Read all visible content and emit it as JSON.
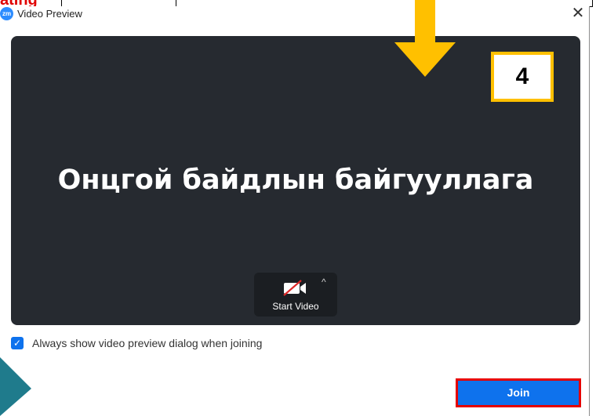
{
  "background_slide": {
    "red_text": "ating"
  },
  "window": {
    "title": "Video Preview",
    "logo_text": "zm",
    "close_glyph": "✕"
  },
  "preview": {
    "display_name": "Онцгой байдлын байгууллага",
    "start_video_label": "Start Video",
    "caret_glyph": "^"
  },
  "overlay": {
    "step_number": "4",
    "arrow_color": "#ffc000"
  },
  "options": {
    "always_show_label": "Always show video preview dialog when joining",
    "always_show_checked": true
  },
  "actions": {
    "join_label": "Join"
  },
  "colors": {
    "accent": "#0e72ed",
    "highlight_border": "#e60000",
    "preview_bg": "#262a30"
  }
}
